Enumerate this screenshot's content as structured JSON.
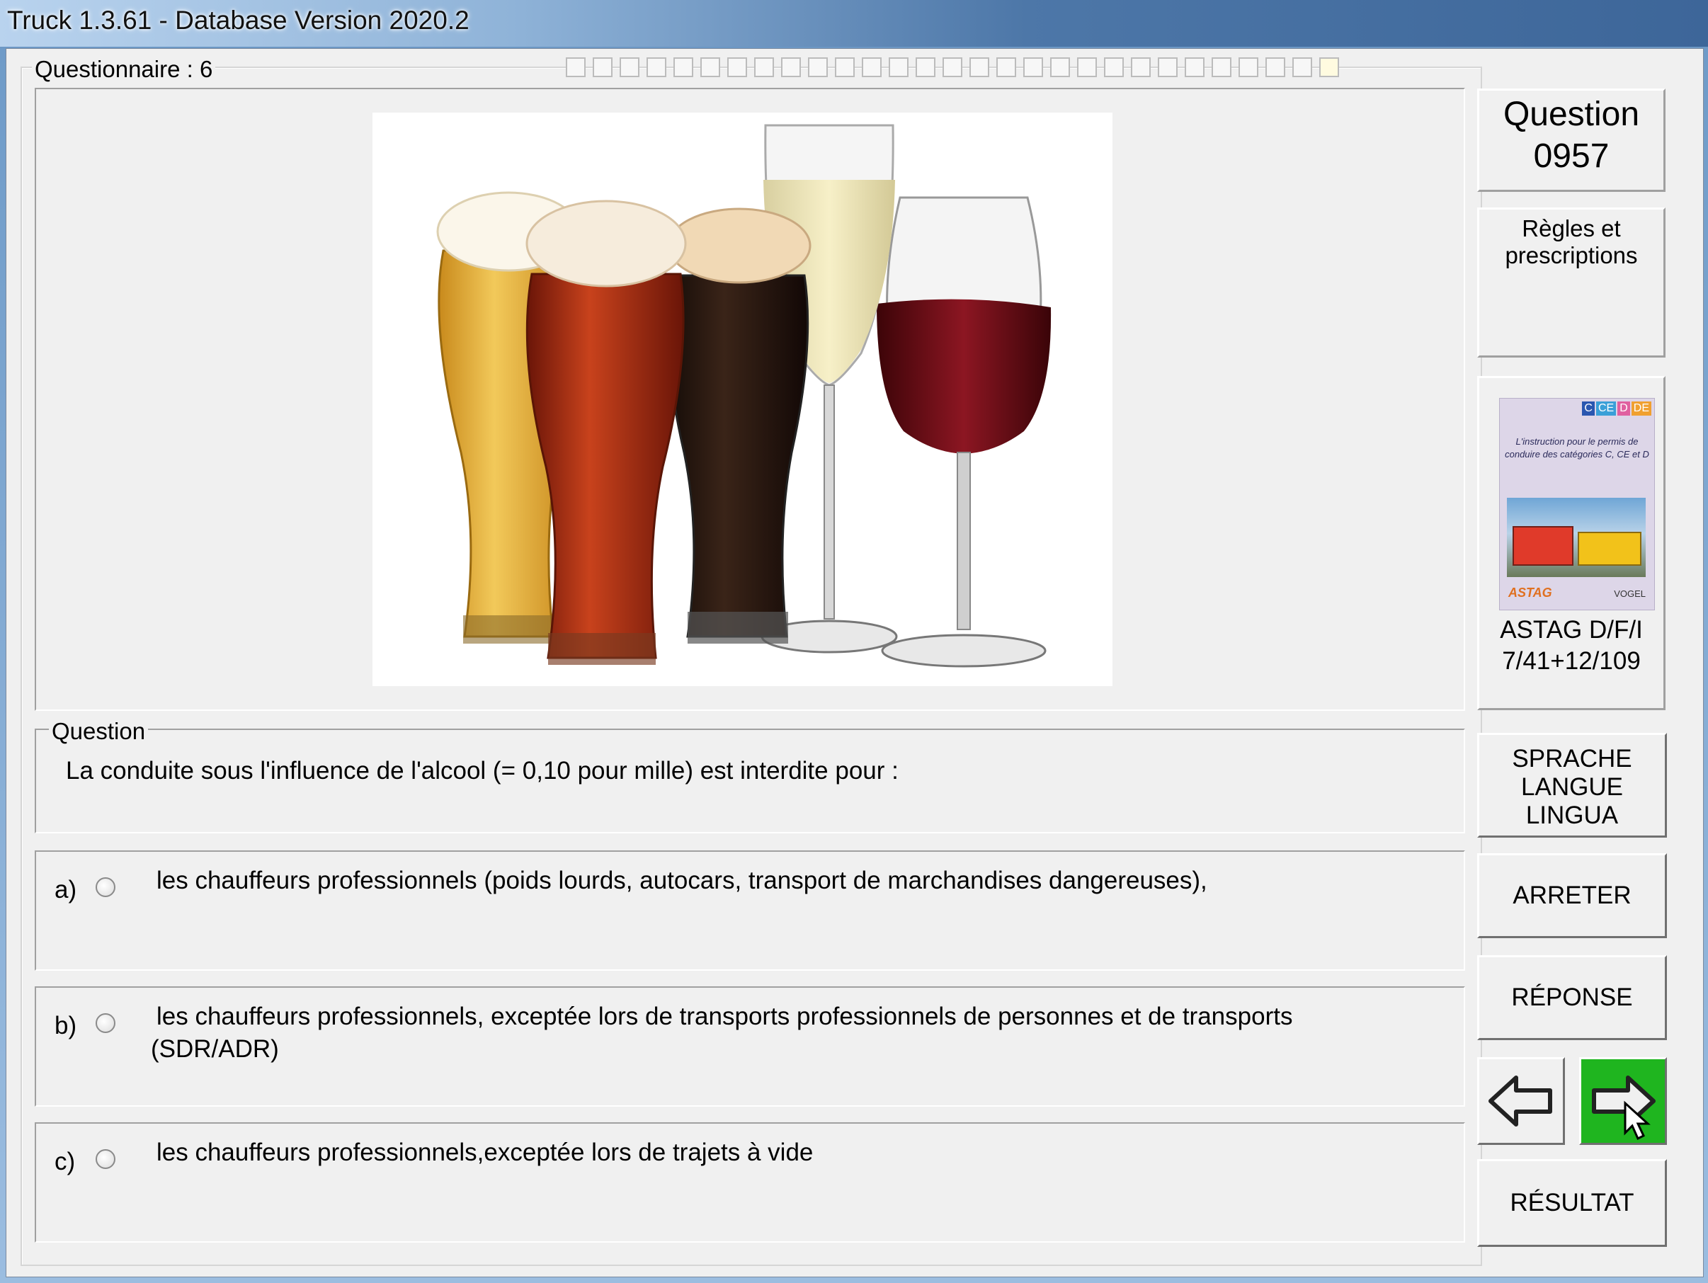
{
  "window": {
    "title": "Truck 1.3.61 - Database Version 2020.2"
  },
  "questionnaire": {
    "label": "Questionnaire : 6",
    "progress_cells": 29,
    "active_cell": 28
  },
  "question_number": {
    "line1": "Question",
    "line2": "0957"
  },
  "category": {
    "line1": "Règles et",
    "line2": "prescriptions"
  },
  "book": {
    "badges": [
      "C",
      "CE",
      "D",
      "DE"
    ],
    "caption": "L'instruction pour le permis de conduire des catégories C, CE et D",
    "publisher1": "ASTAG",
    "publisher2": "VOGEL",
    "ref1": "ASTAG D/F/I",
    "ref2": "7/41+12/109"
  },
  "question": {
    "legend": "Question",
    "text": "La conduite sous l'influence de l'alcool (= 0,10 pour mille) est interdite pour :"
  },
  "answers": [
    {
      "letter": "a)",
      "text": "les chauffeurs professionnels (poids lourds, autocars, transport de marchandises dangereuses),",
      "text2": ""
    },
    {
      "letter": "b)",
      "text": "les chauffeurs professionnels,  exceptée lors de transports professionnels de personnes et de transports",
      "text2": "(SDR/ADR)"
    },
    {
      "letter": "c)",
      "text": "les chauffeurs professionnels,exceptée lors de trajets à vide",
      "text2": ""
    }
  ],
  "buttons": {
    "language": [
      "SPRACHE",
      "LANGUE",
      "LINGUA"
    ],
    "stop": "ARRETER",
    "answer": "RÉPONSE",
    "result": "RÉSULTAT"
  },
  "colors": {
    "next_button": "#1fb51f",
    "panel": "#f0f0f0",
    "beer_light": "#e8b83a",
    "beer_amber": "#a0301a",
    "beer_dark": "#2a1a14",
    "wine": "#6a0f18"
  },
  "icons": {
    "back": "arrow-left-icon",
    "next": "arrow-right-icon",
    "cursor": "mouse-cursor-icon"
  }
}
